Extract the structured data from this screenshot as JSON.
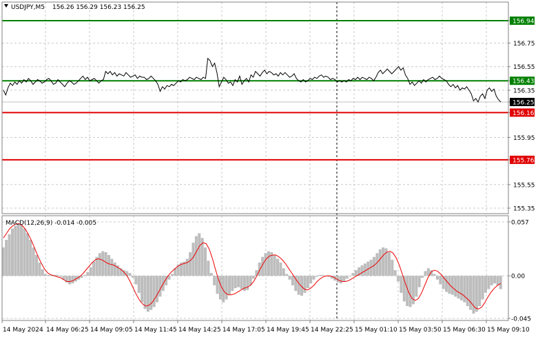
{
  "header": {
    "symbol": "USDJPY,M5",
    "ohlc": "156.26 156.29 156.23 156.25"
  },
  "chart_data": [
    {
      "type": "line",
      "title": "USDJPY,M5",
      "ylim": [
        155.3,
        157.0
      ],
      "y_ticks": [
        "156.94",
        "156.75",
        "156.55",
        "156.43",
        "156.35",
        "156.25",
        "156.16",
        "155.95",
        "155.76",
        "155.55",
        "155.35"
      ],
      "x_ticks": [
        "14 May 2024",
        "14 May 06:25",
        "14 May 09:05",
        "14 May 11:45",
        "14 May 14:25",
        "14 May 17:05",
        "14 May 19:45",
        "14 May 22:25",
        "15 May 01:10",
        "15 May 03:50",
        "15 May 06:30",
        "15 May 09:10"
      ],
      "levels": [
        {
          "value": 156.94,
          "label": "156.94",
          "color": "#008000"
        },
        {
          "value": 156.43,
          "label": "156.43",
          "color": "#008000"
        },
        {
          "value": 156.16,
          "label": "156.16",
          "color": "#e00000"
        },
        {
          "value": 155.76,
          "label": "155.76",
          "color": "#e00000"
        }
      ],
      "current_price": {
        "value": 156.25,
        "label": "156.25"
      },
      "series": [
        {
          "values": [
            156.35,
            156.31,
            156.37,
            156.41,
            156.39,
            156.42,
            156.4,
            156.43,
            156.41,
            156.44,
            156.42,
            156.45,
            156.43,
            156.4,
            156.42,
            156.44,
            156.43,
            156.41,
            156.42,
            156.44,
            156.45,
            156.43,
            156.4,
            156.41,
            156.44,
            156.42,
            156.4,
            156.38,
            156.41,
            156.43,
            156.42,
            156.4,
            156.41,
            156.43,
            156.45,
            156.47,
            156.44,
            156.46,
            156.43,
            156.44,
            156.45,
            156.43,
            156.41,
            156.43,
            156.44,
            156.51,
            156.49,
            156.51,
            156.48,
            156.5,
            156.47,
            156.49,
            156.48,
            156.47,
            156.5,
            156.48,
            156.46,
            156.47,
            156.48,
            156.45,
            156.47,
            156.46,
            156.46,
            156.44,
            156.45,
            156.47,
            156.45,
            156.43,
            156.4,
            156.34,
            156.38,
            156.36,
            156.39,
            156.38,
            156.4,
            156.39,
            156.41,
            156.43,
            156.42,
            156.44,
            156.43,
            156.44,
            156.46,
            156.45,
            156.44,
            156.46,
            156.45,
            156.44,
            156.46,
            156.45,
            156.62,
            156.6,
            156.55,
            156.58,
            156.5,
            156.38,
            156.42,
            156.46,
            156.44,
            156.41,
            156.42,
            156.39,
            156.44,
            156.42,
            156.47,
            156.4,
            156.43,
            156.45,
            156.42,
            156.48,
            156.46,
            156.51,
            156.49,
            156.47,
            156.5,
            156.52,
            156.49,
            156.51,
            156.5,
            156.48,
            156.49,
            156.47,
            156.5,
            156.48,
            156.5,
            156.48,
            156.46,
            156.47,
            156.49,
            156.45,
            156.43,
            156.42,
            156.44,
            156.42,
            156.43,
            156.45,
            156.44,
            156.46,
            156.45,
            156.47,
            156.48,
            156.46,
            156.47,
            156.46,
            156.44,
            156.45,
            156.44,
            156.42,
            156.43,
            156.42,
            156.43,
            156.42,
            156.44,
            156.43,
            156.45,
            156.44,
            156.46,
            156.44,
            156.46,
            156.45,
            156.44,
            156.46,
            156.45,
            156.43,
            156.46,
            156.5,
            156.52,
            156.49,
            156.51,
            156.53,
            156.51,
            156.49,
            156.51,
            156.53,
            156.55,
            156.52,
            156.54,
            156.48,
            156.45,
            156.4,
            156.42,
            156.39,
            156.41,
            156.43,
            156.41,
            156.44,
            156.42,
            156.44,
            156.45,
            156.46,
            156.44,
            156.45,
            156.47,
            156.45,
            156.44,
            156.43,
            156.4,
            156.38,
            156.4,
            156.37,
            156.39,
            156.35,
            156.37,
            156.36,
            156.38,
            156.35,
            156.32,
            156.26,
            156.28,
            156.25,
            156.3,
            156.32,
            156.28,
            156.35,
            156.37,
            156.34,
            156.36,
            156.3,
            156.27,
            156.25
          ]
        }
      ]
    },
    {
      "type": "bar",
      "title": "MACD(12,26,9) -0.014 -0.005",
      "ylim": [
        -0.047,
        0.06
      ],
      "y_ticks": [
        "0.057",
        "0.00",
        "-0.045"
      ],
      "histogram": [
        0.03,
        0.038,
        0.044,
        0.05,
        0.053,
        0.055,
        0.054,
        0.05,
        0.045,
        0.038,
        0.03,
        0.022,
        0.014,
        0.007,
        0.002,
        0.001,
        0.001,
        0.001,
        0.001,
        -0.001,
        -0.004,
        -0.007,
        -0.009,
        -0.008,
        -0.006,
        -0.004,
        -0.002,
        0.001,
        0.004,
        0.009,
        0.015,
        0.02,
        0.024,
        0.026,
        0.025,
        0.022,
        0.018,
        0.014,
        0.011,
        0.008,
        0.006,
        0.005,
        0.003,
        -0.002,
        -0.009,
        -0.018,
        -0.028,
        -0.035,
        -0.038,
        -0.036,
        -0.033,
        -0.028,
        -0.022,
        -0.016,
        -0.01,
        -0.004,
        0.002,
        0.008,
        0.012,
        0.014,
        0.015,
        0.018,
        0.025,
        0.035,
        0.042,
        0.045,
        0.04,
        0.03,
        0.016,
        0.003,
        -0.01,
        -0.019,
        -0.025,
        -0.028,
        -0.025,
        -0.02,
        -0.016,
        -0.013,
        -0.012,
        -0.014,
        -0.016,
        -0.015,
        -0.01,
        -0.003,
        0.006,
        0.014,
        0.02,
        0.024,
        0.026,
        0.025,
        0.022,
        0.018,
        0.014,
        0.008,
        0.002,
        -0.004,
        -0.01,
        -0.016,
        -0.02,
        -0.021,
        -0.018,
        -0.013,
        -0.008,
        -0.004,
        -0.001,
        0.001,
        0.001,
        0.0,
        -0.001,
        -0.003,
        -0.005,
        -0.007,
        -0.008,
        -0.006,
        -0.003,
        0.0,
        0.003,
        0.006,
        0.009,
        0.011,
        0.013,
        0.015,
        0.017,
        0.02,
        0.024,
        0.028,
        0.03,
        0.029,
        0.025,
        0.017,
        0.006,
        -0.006,
        -0.018,
        -0.027,
        -0.032,
        -0.033,
        -0.03,
        -0.022,
        -0.012,
        -0.002,
        0.005,
        0.008,
        0.006,
        0.002,
        -0.004,
        -0.009,
        -0.014,
        -0.017,
        -0.019,
        -0.02,
        -0.022,
        -0.024,
        -0.026,
        -0.028,
        -0.032,
        -0.036,
        -0.04,
        -0.038,
        -0.032,
        -0.025,
        -0.018,
        -0.014,
        -0.01,
        -0.008,
        -0.01,
        -0.014
      ],
      "signal": [
        0.04,
        0.045,
        0.05,
        0.053,
        0.055,
        0.055,
        0.053,
        0.049,
        0.043,
        0.036,
        0.028,
        0.02,
        0.013,
        0.007,
        0.003,
        0.001,
        0.0,
        -0.001,
        -0.002,
        -0.004,
        -0.006,
        -0.006,
        -0.005,
        -0.003,
        -0.001,
        0.002,
        0.006,
        0.01,
        0.014,
        0.017,
        0.018,
        0.017,
        0.015,
        0.013,
        0.012,
        0.011,
        0.009,
        0.007,
        0.004,
        0.0,
        -0.006,
        -0.013,
        -0.02,
        -0.026,
        -0.03,
        -0.032,
        -0.031,
        -0.028,
        -0.023,
        -0.017,
        -0.011,
        -0.005,
        0.0,
        0.004,
        0.007,
        0.01,
        0.012,
        0.013,
        0.014,
        0.016,
        0.02,
        0.026,
        0.032,
        0.035,
        0.034,
        0.028,
        0.018,
        0.006,
        -0.005,
        -0.013,
        -0.018,
        -0.02,
        -0.02,
        -0.019,
        -0.017,
        -0.015,
        -0.013,
        -0.012,
        -0.01,
        -0.006,
        0.0,
        0.007,
        0.013,
        0.018,
        0.021,
        0.022,
        0.022,
        0.02,
        0.017,
        0.013,
        0.008,
        0.003,
        -0.002,
        -0.007,
        -0.011,
        -0.014,
        -0.015,
        -0.013,
        -0.01,
        -0.006,
        -0.003,
        -0.001,
        0.0,
        0.0,
        -0.001,
        -0.003,
        -0.005,
        -0.006,
        -0.006,
        -0.005,
        -0.003,
        -0.001,
        0.001,
        0.003,
        0.005,
        0.007,
        0.009,
        0.011,
        0.014,
        0.018,
        0.022,
        0.025,
        0.026,
        0.024,
        0.019,
        0.011,
        0.001,
        -0.009,
        -0.018,
        -0.024,
        -0.026,
        -0.024,
        -0.018,
        -0.01,
        -0.002,
        0.004,
        0.006,
        0.005,
        0.002,
        -0.002,
        -0.006,
        -0.01,
        -0.013,
        -0.016,
        -0.018,
        -0.02,
        -0.023,
        -0.026,
        -0.03,
        -0.034,
        -0.035,
        -0.033,
        -0.028,
        -0.022,
        -0.017,
        -0.013,
        -0.01,
        -0.008
      ]
    }
  ]
}
